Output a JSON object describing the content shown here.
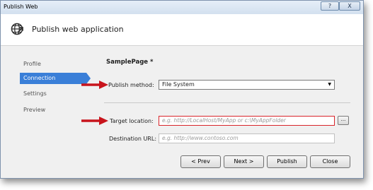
{
  "window": {
    "title": "Publish Web",
    "help_label": "?",
    "close_label": "X",
    "header_title": "Publish web application"
  },
  "sidebar": {
    "items": [
      {
        "label": "Profile",
        "active": false
      },
      {
        "label": "Connection",
        "active": true
      },
      {
        "label": "Settings",
        "active": false
      },
      {
        "label": "Preview",
        "active": false
      }
    ]
  },
  "main": {
    "page_heading": "SamplePage *",
    "publish_method": {
      "label": "Publish method:",
      "value": "File System"
    },
    "target_location": {
      "label": "Target location:",
      "placeholder": "e.g. http://LocalHost/MyApp or c:\\MyAppFolder",
      "browse_label": "..."
    },
    "destination_url": {
      "label": "Destination URL:",
      "placeholder": "e.g. http://www.contoso.com"
    }
  },
  "footer": {
    "prev_label": "< Prev",
    "next_label": "Next >",
    "publish_label": "Publish",
    "close_label": "Close"
  },
  "annotations": {
    "arrow_color": "#c8141c",
    "accent_color": "#3a7fd8",
    "error_border_color": "#d9252b"
  }
}
